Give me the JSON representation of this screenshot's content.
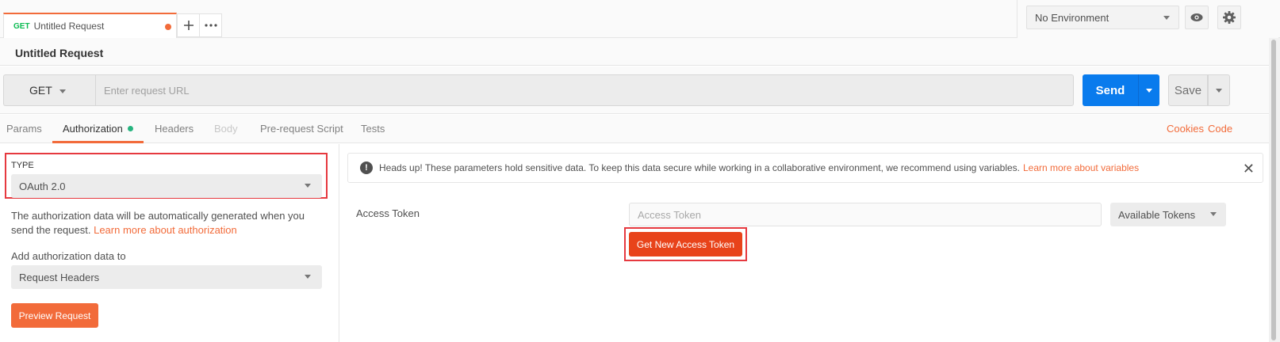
{
  "tabbar": {
    "tab": {
      "method": "GET",
      "name": "Untitled Request",
      "unsaved_icon": "dot-icon"
    },
    "add_icon": "plus-icon",
    "more_icon": "ellipsis-icon",
    "environment": {
      "selected": "No Environment"
    },
    "eye_icon": "eye-icon",
    "settings_icon": "gear-icon"
  },
  "request": {
    "title": "Untitled Request",
    "method": "GET",
    "url_placeholder": "Enter request URL",
    "send_label": "Send",
    "save_label": "Save"
  },
  "request_tabs": {
    "items": [
      {
        "label": "Params"
      },
      {
        "label": "Authorization"
      },
      {
        "label": "Headers"
      },
      {
        "label": "Body"
      },
      {
        "label": "Pre-request Script"
      },
      {
        "label": "Tests"
      }
    ],
    "active": "Authorization",
    "cookies_label": "Cookies",
    "code_label": "Code"
  },
  "auth": {
    "type_label": "TYPE",
    "type_value": "OAuth 2.0",
    "description": "The authorization data will be automatically generated when you send the request.",
    "learn_more": "Learn more about authorization",
    "add_to_label": "Add authorization data to",
    "add_to_value": "Request Headers",
    "preview_label": "Preview Request"
  },
  "alert": {
    "text": "Heads up! These parameters hold sensitive data. To keep this data secure while working in a collaborative environment, we recommend using variables.",
    "link": "Learn more about variables"
  },
  "oauth": {
    "access_token_label": "Access Token",
    "access_token_placeholder": "Access Token",
    "available_tokens": "Available Tokens",
    "get_token_label": "Get New Access Token"
  },
  "colors": {
    "accent": "#f26b3a",
    "send": "#097bed",
    "highlight": "#e6393f",
    "method_get": "#0cbb52"
  }
}
